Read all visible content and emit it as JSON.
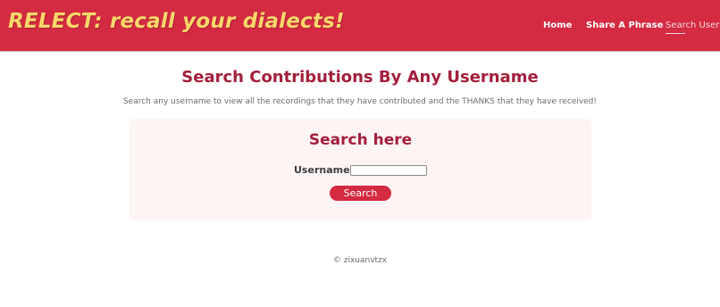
{
  "header": {
    "brand": "RELECT: recall your dialects!",
    "nav": [
      {
        "label": "Home",
        "active": false
      },
      {
        "label": "Share A Phrase",
        "active": false
      },
      {
        "label": "Search User",
        "active": true
      }
    ]
  },
  "main": {
    "heading": "Search Contributions By Any Username",
    "description": "Search any username to view all the recordings that they have contributed and the THANKS that they have received!",
    "search_card": {
      "title": "Search here",
      "username_label": "Username:",
      "username_value": "",
      "button_label": "Search"
    }
  },
  "footer": {
    "text": "© zixuanvtzx"
  },
  "colors": {
    "header_bg": "#d42a42",
    "brand_text": "#f6d86a",
    "heading": "#a31f3b",
    "card_bg": "#fdf4f4",
    "button_bg": "#d42a42"
  }
}
